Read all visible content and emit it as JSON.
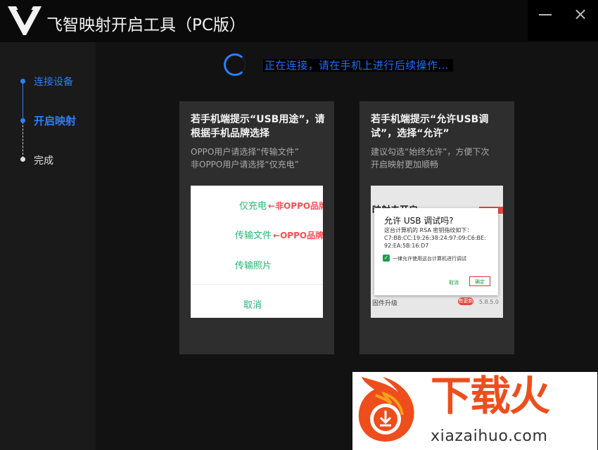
{
  "app": {
    "title": "飞智映射开启工具（PC版）"
  },
  "window_controls": {
    "minimize": "minimize",
    "close": "×"
  },
  "steps": [
    {
      "label": "连接设备",
      "state": "done"
    },
    {
      "label": "开启映射",
      "state": "active"
    },
    {
      "label": "完成",
      "state": "pending"
    }
  ],
  "status": {
    "text": "正在连接，请在手机上进行后续操作..."
  },
  "cards": [
    {
      "title": "若手机端提示“USB用途”，请根据手机品牌选择",
      "desc_lines": [
        "OPPO用户请选择“传输文件”",
        "非OPPO用户请选择“仅充电”"
      ],
      "demo": {
        "items": [
          {
            "label": "仅充电",
            "note": "←非OPPO品牌"
          },
          {
            "label": "传输文件",
            "note": "←OPPO品牌"
          },
          {
            "label": "传输照片",
            "note": ""
          }
        ],
        "cancel": "取消"
      }
    },
    {
      "title": "若手机端提示“允许USB调试”，选择“允许”",
      "desc_lines": [
        "建议勾选“始终允许”，方便下次",
        "开启映射更加顺畅"
      ],
      "demo": {
        "bg_title": "映射未开启",
        "bg_row_label": "固件升级",
        "bg_row_badge": "有更新",
        "bg_row_version": "5.8.5.0",
        "dialog": {
          "title": "允许 USB 调试吗?",
          "body_lines": [
            "这台计算机的 RSA 密钥指纹如下：",
            "C7:BB:CC:19:26:38:24:97:09:C6:BE:",
            "92:EA:5B:16:D7"
          ],
          "checkbox": "一律允许使用这台计算机进行调试",
          "cancel": "取消",
          "ok": "确定"
        }
      }
    }
  ],
  "watermark": {
    "chars": "下载火",
    "url": "xiazaihuo.com"
  },
  "colors": {
    "accent": "#1e6fff",
    "green": "#22b573",
    "red": "#ff4b55",
    "brand_orange": "#ee4e1c"
  }
}
